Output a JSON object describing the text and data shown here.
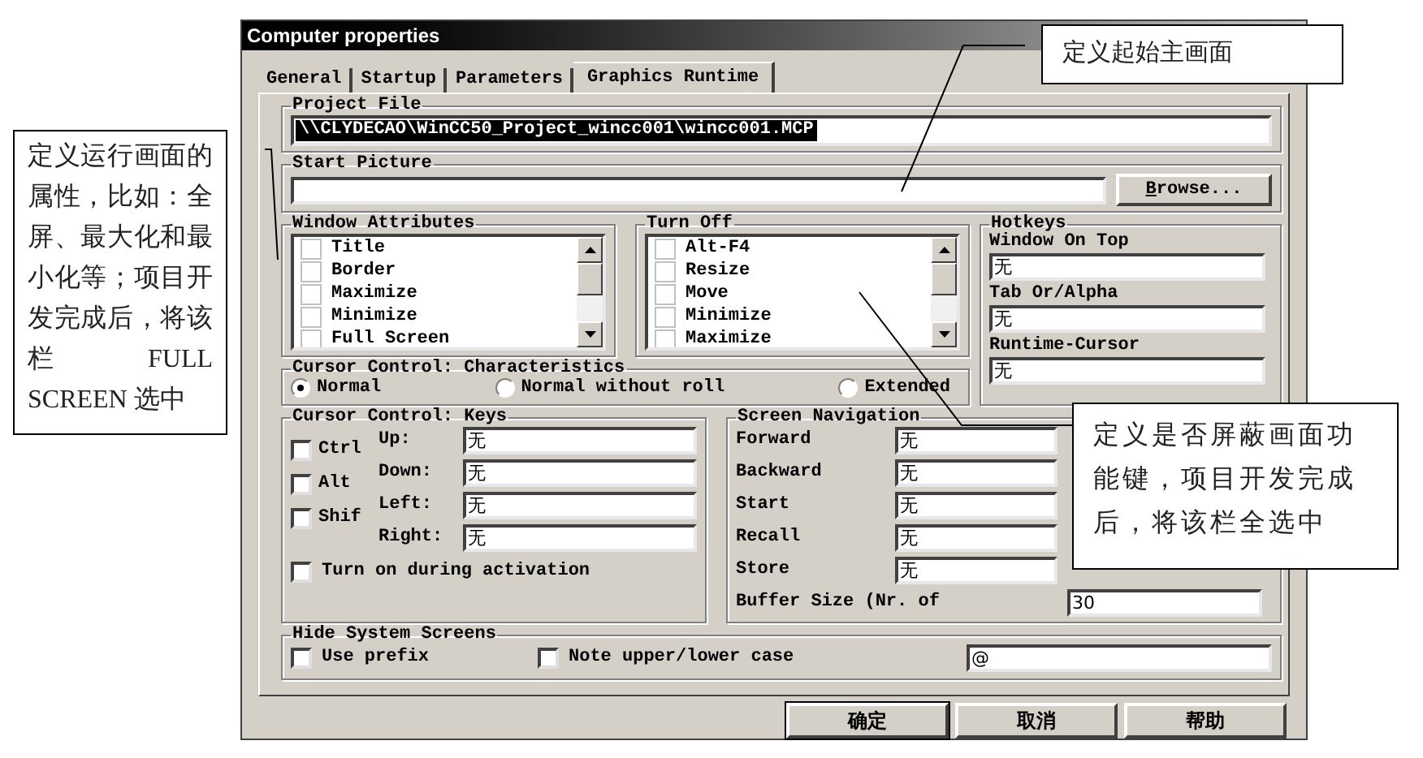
{
  "window": {
    "title": "Computer properties"
  },
  "tabs": [
    {
      "label": "General",
      "selected": false
    },
    {
      "label": "Startup",
      "selected": false
    },
    {
      "label": "Parameters",
      "selected": false
    },
    {
      "label": "Graphics Runtime",
      "selected": true
    }
  ],
  "project_file": {
    "label": "Project File",
    "value": "\\\\CLYDECAO\\WinCC50_Project_wincc001\\wincc001.MCP",
    "highlighted": true
  },
  "start_picture": {
    "label": "Start Picture",
    "button": "Browse..."
  },
  "window_attributes": {
    "label": "Window Attributes",
    "items": [
      {
        "label": "Title",
        "checked": false
      },
      {
        "label": "Border",
        "checked": false
      },
      {
        "label": "Maximize",
        "checked": false
      },
      {
        "label": "Minimize",
        "checked": false
      },
      {
        "label": "Full Screen",
        "checked": false
      }
    ]
  },
  "turn_off": {
    "label": "Turn Off",
    "items": [
      {
        "label": "Alt-F4",
        "checked": false
      },
      {
        "label": "Resize",
        "checked": false
      },
      {
        "label": "Move",
        "checked": false
      },
      {
        "label": "Minimize",
        "checked": false
      },
      {
        "label": "Maximize",
        "checked": false
      }
    ]
  },
  "hotkeys": {
    "label": "Hotkeys",
    "fields": [
      {
        "label": "Window On Top",
        "value": "无"
      },
      {
        "label": "Tab Or/Alpha",
        "value": "无"
      },
      {
        "label": "Runtime-Cursor",
        "value": "无"
      }
    ]
  },
  "cursor_characteristics": {
    "label": "Cursor Control: Characteristics",
    "options": [
      {
        "label": "Normal",
        "selected": true
      },
      {
        "label": "Normal without roll",
        "selected": false
      },
      {
        "label": "Extended",
        "selected": false
      }
    ]
  },
  "cursor_keys": {
    "label": "Cursor Control: Keys",
    "modifiers": [
      {
        "label": "Ctrl",
        "checked": false
      },
      {
        "label": "Alt",
        "checked": false
      },
      {
        "label": "Shif",
        "checked": false
      }
    ],
    "fields": [
      {
        "label": "Up:",
        "value": "无"
      },
      {
        "label": "Down:",
        "value": "无"
      },
      {
        "label": "Left:",
        "value": "无"
      },
      {
        "label": "Right:",
        "value": "无"
      }
    ],
    "activation": {
      "label": "Turn on during activation",
      "checked": false
    }
  },
  "screen_navigation": {
    "label": "Screen Navigation",
    "fields": [
      {
        "label": "Forward",
        "value": "无"
      },
      {
        "label": "Backward",
        "value": "无"
      },
      {
        "label": "Start",
        "value": "无"
      },
      {
        "label": "Recall",
        "value": "无"
      },
      {
        "label": "Store",
        "value": "无"
      }
    ],
    "buffer": {
      "label": "Buffer Size (Nr. of",
      "value": "30"
    }
  },
  "hide_system_screens": {
    "label": "Hide System Screens",
    "use_prefix": {
      "label": "Use prefix",
      "checked": false
    },
    "note_case": {
      "label": "Note upper/lower case",
      "checked": false
    },
    "value": "@"
  },
  "buttons": [
    {
      "label": "确定",
      "default": true
    },
    {
      "label": "取消",
      "default": false
    },
    {
      "label": "帮助",
      "default": false
    }
  ],
  "annotations": [
    {
      "text": "定义运行画面的属性，比如：全屏、最大化和最小化等；项目开发完成后，将该栏 FULL SCREEN 选中"
    },
    {
      "text": "定义起始主画面"
    },
    {
      "text": "定义是否屏蔽画面功能键，项目开发完成后，将该栏全选中"
    }
  ]
}
